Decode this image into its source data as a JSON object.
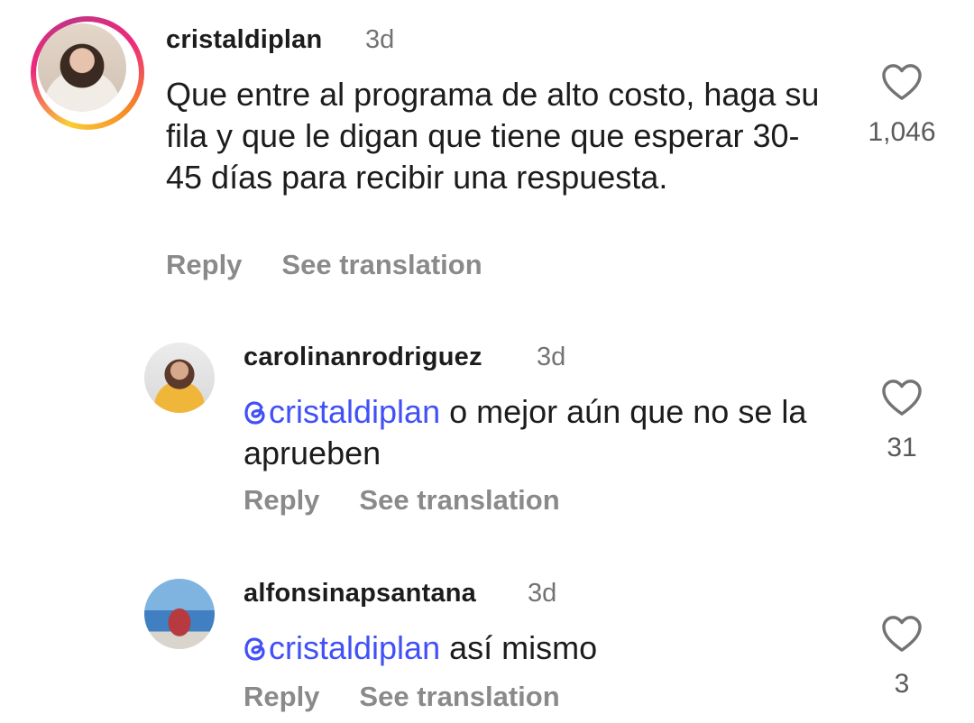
{
  "comments": [
    {
      "username": "cristaldiplan",
      "time": "3d",
      "text": "Que entre al programa de alto costo, haga su fila y que le digan que tiene que esperar 30-45 días para recibir una respuesta.",
      "likes": "1,046",
      "reply_label": "Reply",
      "translation_label": "See translation",
      "avatar_icon": "avatar-photo"
    },
    {
      "username": "carolinanrodriguez",
      "time": "3d",
      "mention": "cristaldiplan",
      "text": "o mejor aún que no se la aprueben",
      "likes": "31",
      "reply_label": "Reply",
      "translation_label": "See translation",
      "avatar_icon": "avatar-photo"
    },
    {
      "username": "alfonsinapsantana",
      "time": "3d",
      "mention": "cristaldiplan",
      "text": "así mismo",
      "likes": "3",
      "reply_label": "Reply",
      "translation_label": "See translation",
      "avatar_icon": "avatar-photo"
    }
  ],
  "colors": {
    "mention": "#4150f7",
    "muted": "#737373",
    "action": "#8a8a8a",
    "text": "#1c1c1c"
  }
}
